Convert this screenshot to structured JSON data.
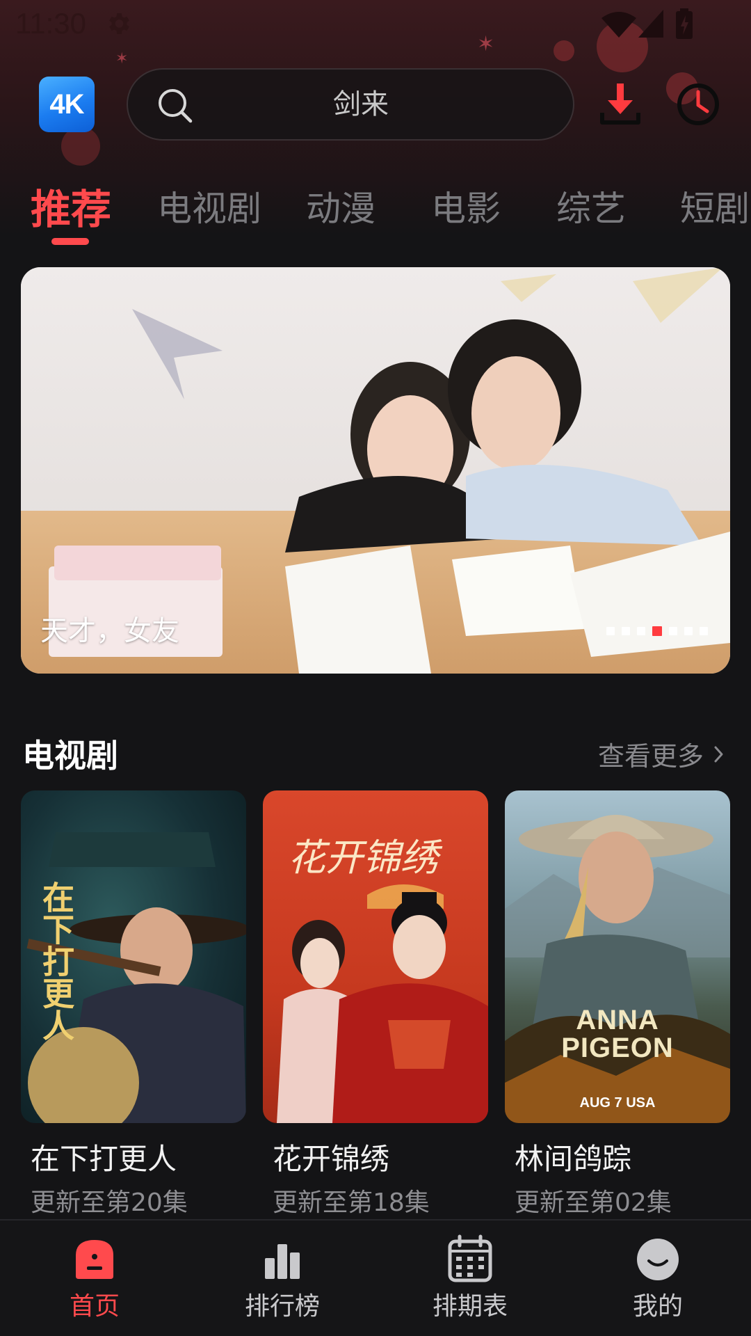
{
  "status_bar": {
    "time": "11:30"
  },
  "header": {
    "logo_text": "4K",
    "search": {
      "value": "剑来"
    }
  },
  "tabs": [
    {
      "label": "推荐",
      "active": true
    },
    {
      "label": "电视剧",
      "active": false
    },
    {
      "label": "动漫",
      "active": false
    },
    {
      "label": "电影",
      "active": false
    },
    {
      "label": "综艺",
      "active": false
    },
    {
      "label": "短剧",
      "active": false
    }
  ],
  "banner": {
    "caption": "天才，女友",
    "dot_count": 7,
    "active_dot_index": 3
  },
  "tv_section": {
    "title": "电视剧",
    "see_more": "查看更多",
    "items": [
      {
        "title": "在下打更人",
        "subtitle": "更新至第20集",
        "poster_text": "在下打更人"
      },
      {
        "title": "花开锦绣",
        "subtitle": "更新至第18集",
        "poster_text": "花开锦绣"
      },
      {
        "title": "林间鸽踪",
        "subtitle": "更新至第02集",
        "poster_text": "ANNA PIGEON",
        "poster_sub": "AUG 7 USA"
      }
    ]
  },
  "bottom_nav": [
    {
      "label": "首页",
      "icon": "home-icon",
      "active": true
    },
    {
      "label": "排行榜",
      "icon": "ranking-icon",
      "active": false
    },
    {
      "label": "排期表",
      "icon": "calendar-icon",
      "active": false
    },
    {
      "label": "我的",
      "icon": "profile-icon",
      "active": false
    }
  ],
  "colors": {
    "accent": "#ff4a4d",
    "background": "#141416",
    "logo_blue": "#1b7cf0"
  }
}
